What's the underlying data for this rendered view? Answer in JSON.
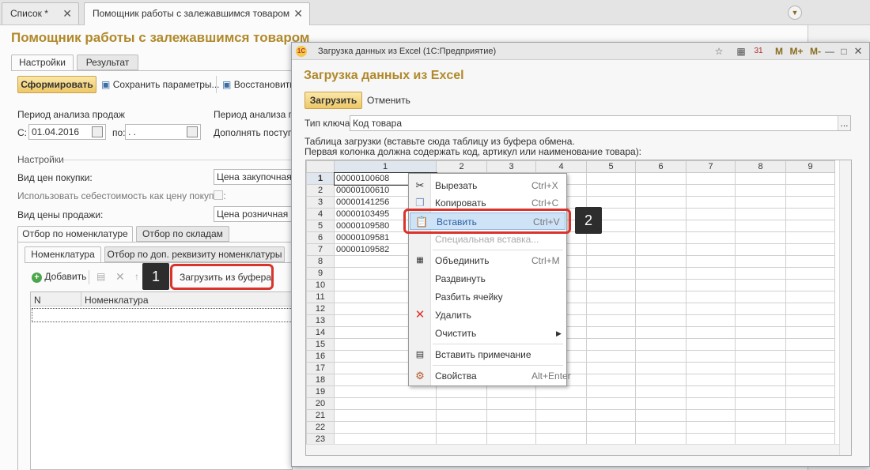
{
  "tabs": {
    "list": "Список *",
    "helper": "Помощник работы с залежавшимся товаром"
  },
  "main": {
    "title": "Помощник работы с залежавшимся товаром",
    "tab_settings": "Настройки",
    "tab_result": "Результат",
    "btn_form": "Сформировать",
    "btn_save_params": "Сохранить параметры...",
    "btn_restore": "Восстановить",
    "period_label": "Период анализа продаж",
    "period_label2": "Период анализа по",
    "from_label": "С:",
    "from_value": "01.04.2016",
    "to_label": "по:",
    "to_value": " .  .",
    "supplement_label": "Дополнять поступл",
    "settings_section": "Настройки",
    "purchase_price_label": "Вид цен покупки:",
    "purchase_price_value": "Цена закупочная Н",
    "use_cost_label": "Использовать себестоимость как цену покупки:",
    "sale_price_label": "Вид цены продажи:",
    "sale_price_value": "Цена розничная НТ",
    "filter_tab1": "Отбор по номенклатуре",
    "filter_tab2": "Отбор по складам",
    "sub_tab1": "Номенклатура",
    "sub_tab2": "Отбор по доп. реквизиту номенклатуры",
    "add_label": "Добавить",
    "load_buffer_label": "Загрузить из буфера",
    "col_n": "N",
    "col_nom": "Номенклатура"
  },
  "dialog": {
    "window_title": "Загрузка данных из Excel  (1С:Предприятие)",
    "title": "Загрузка данных из Excel",
    "load_btn": "Загрузить",
    "cancel_btn": "Отменить",
    "key_type_label": "Тип ключа:",
    "key_type_value": "Код товара",
    "instruction1": "Таблица загрузки (вставьте сюда таблицу из буфера обмена.",
    "instruction2": "Первая колонка должна содержать код, артикул или наименование товара):",
    "title_buttons": [
      "M",
      "M+",
      "M-"
    ],
    "col_headers": [
      "1",
      "2",
      "3",
      "4",
      "5",
      "6",
      "7",
      "8",
      "9"
    ],
    "rows": [
      "1",
      "2",
      "3",
      "4",
      "5",
      "6",
      "7",
      "8",
      "9",
      "10",
      "11",
      "12",
      "13",
      "14",
      "15",
      "16",
      "17",
      "18",
      "19",
      "20",
      "21",
      "22",
      "23"
    ],
    "codes": [
      "00000100608",
      "00000100610",
      "00000141256",
      "00000103495",
      "00000109580",
      "00000109581",
      "00000109582"
    ]
  },
  "context_menu": {
    "cut": {
      "label": "Вырезать",
      "key": "Ctrl+X"
    },
    "copy": {
      "label": "Копировать",
      "key": "Ctrl+C"
    },
    "paste": {
      "label": "Вставить",
      "key": "Ctrl+V"
    },
    "paste_special": {
      "label": "Специальная вставка..."
    },
    "merge": {
      "label": "Объединить",
      "key": "Ctrl+M"
    },
    "unmerge": {
      "label": "Раздвинуть"
    },
    "split": {
      "label": "Разбить ячейку"
    },
    "delete": {
      "label": "Удалить"
    },
    "clear": {
      "label": "Очистить"
    },
    "insert_note": {
      "label": "Вставить примечание"
    },
    "properties": {
      "label": "Свойства",
      "key": "Alt+Enter"
    }
  },
  "annotations": {
    "badge1": "1",
    "badge2": "2"
  },
  "colors": {
    "accent": "#b0892a",
    "highlight": "#d9332b",
    "selected_item": "#cfe3f7"
  }
}
